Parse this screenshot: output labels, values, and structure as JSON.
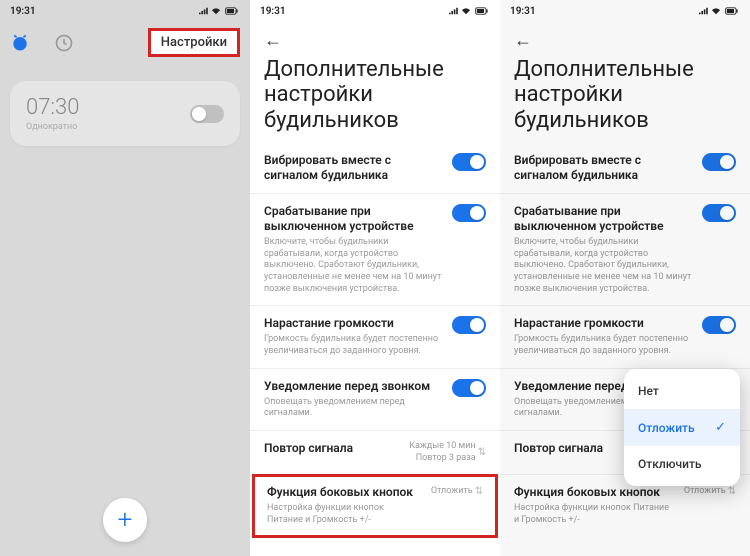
{
  "statusbar": {
    "time": "19:31",
    "battery": "80"
  },
  "phone1": {
    "tab_settings": "Настройки",
    "alarm_time": "07:30",
    "alarm_repeat": "Однократно"
  },
  "settings": {
    "title": "Дополнительные настройки будильников",
    "rows": {
      "vibrate": {
        "title": "Вибрировать вместе с сигналом будильника"
      },
      "poweroff": {
        "title": "Срабатывание при выключенном устройстве",
        "desc": "Включите, чтобы будильники срабатывали, когда устройство выключено. Сработают будильники, установленные не менее чем на 10 минут позже выключения устройства."
      },
      "ascend": {
        "title": "Нарастание громкости",
        "desc": "Громкость будильника будет постепенно увеличиваться до заданного уровня."
      },
      "notify": {
        "title": "Уведомление перед звонком",
        "desc": "Оповещать уведомлением перед сигналами."
      },
      "repeat": {
        "title": "Повтор сигнала",
        "val1": "Каждые 10 мин",
        "val2": "Повтор 3 раза"
      },
      "sidebtn": {
        "title": "Функция боковых кнопок",
        "desc": "Настройка функции кнопок Питание и Громкость +/-",
        "val": "Отложить"
      }
    }
  },
  "popup": {
    "opt_none": "Нет",
    "opt_snooze": "Отложить",
    "opt_off": "Отключить"
  }
}
